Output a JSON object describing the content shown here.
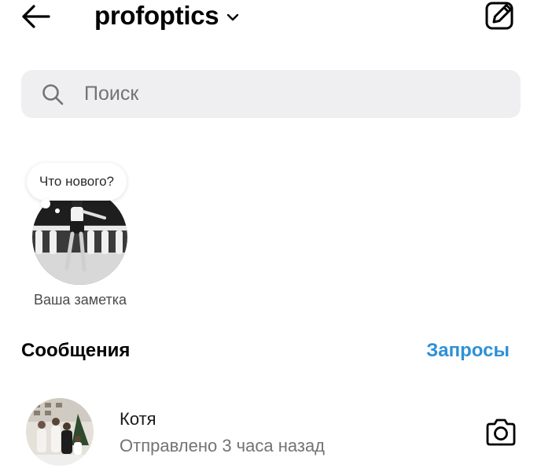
{
  "header": {
    "back_icon": "arrow-left-icon",
    "username": "profoptics",
    "chevron_icon": "chevron-down-icon",
    "compose_icon": "compose-icon"
  },
  "search": {
    "icon": "search-icon",
    "placeholder": "Поиск",
    "value": ""
  },
  "note": {
    "bubble_text": "Что нового?",
    "label": "Ваша заметка"
  },
  "messages": {
    "heading": "Сообщения",
    "requests_label": "Запросы",
    "requests_color": "#2d90d8",
    "conversations": [
      {
        "name": "Котя",
        "status": "Отправлено 3 часа назад",
        "action_icon": "camera-icon"
      }
    ]
  }
}
